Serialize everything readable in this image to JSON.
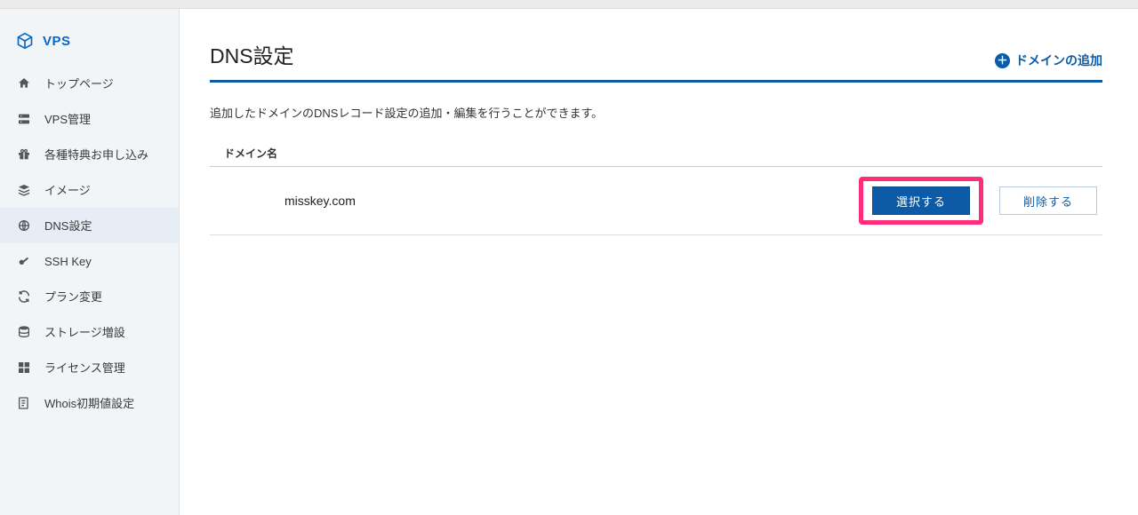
{
  "brand": {
    "label": "VPS"
  },
  "sidebar": {
    "items": [
      {
        "label": "トップページ"
      },
      {
        "label": "VPS管理"
      },
      {
        "label": "各種特典お申し込み"
      },
      {
        "label": "イメージ"
      },
      {
        "label": "DNS設定"
      },
      {
        "label": "SSH Key"
      },
      {
        "label": "プラン変更"
      },
      {
        "label": "ストレージ増設"
      },
      {
        "label": "ライセンス管理"
      },
      {
        "label": "Whois初期値設定"
      }
    ]
  },
  "page": {
    "title": "DNS設定",
    "add_domain_label": "ドメインの追加",
    "description": "追加したドメインのDNSレコード設定の追加・編集を行うことができます。"
  },
  "table": {
    "header_domain": "ドメイン名",
    "rows": [
      {
        "domain_visible": "misskey.com",
        "select_label": "選択する",
        "delete_label": "削除する"
      }
    ]
  }
}
